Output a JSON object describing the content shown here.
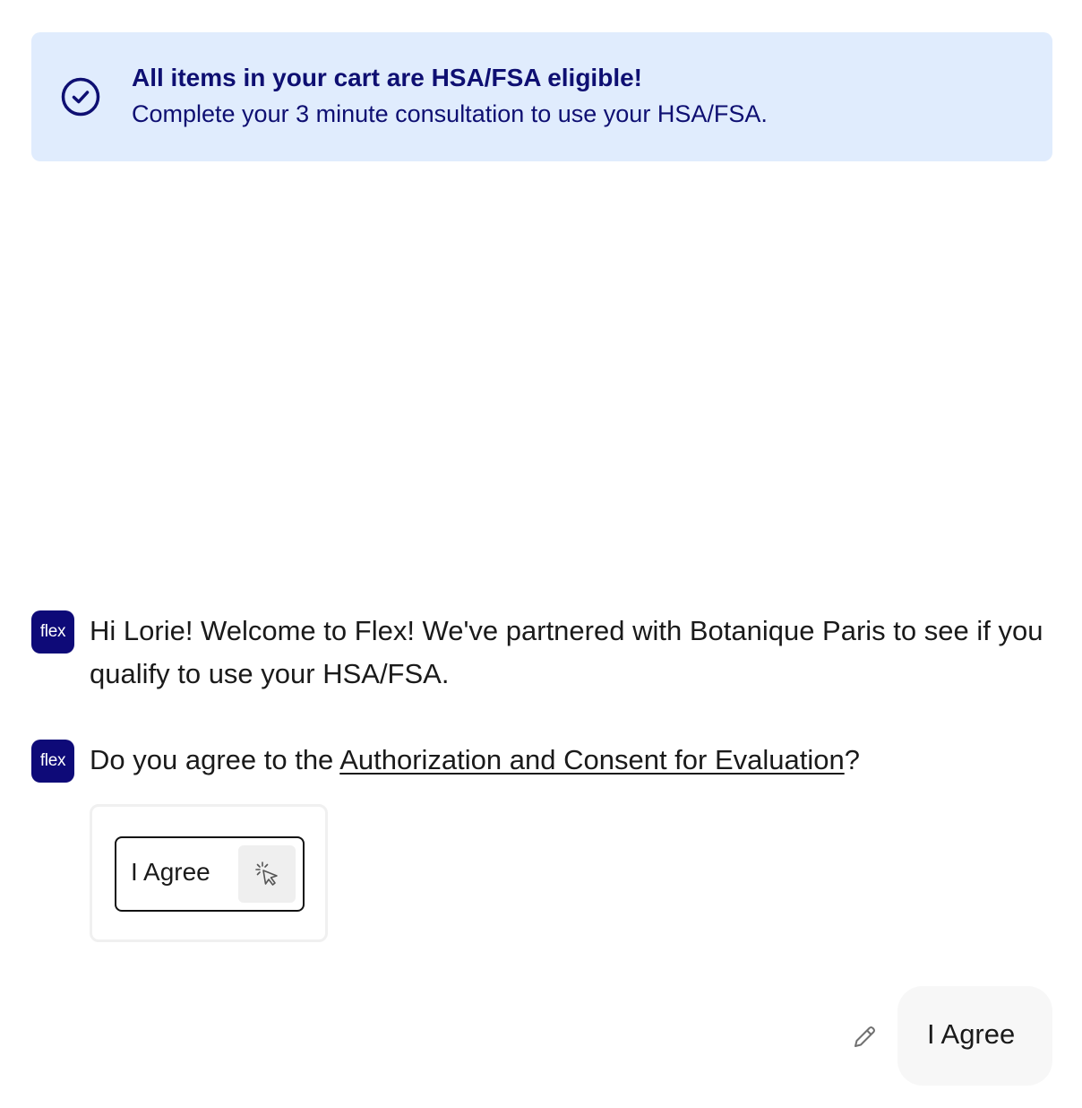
{
  "banner": {
    "title": "All items in your cart are HSA/FSA eligible!",
    "subtitle": "Complete your 3 minute consultation to use your HSA/FSA.",
    "icon": "check-circle-icon",
    "background": "#e0ecfd",
    "text_color": "#0e0f72"
  },
  "chat": {
    "avatar_label": "flex",
    "avatar_color": "#0e0a78",
    "messages": [
      {
        "sender": "bot",
        "text": "Hi Lorie! Welcome to Flex! We've partnered with Botanique Paris to see if you qualify to use your HSA/FSA."
      },
      {
        "sender": "bot",
        "prefix": "Do you agree to the ",
        "link_text": "Authorization and Consent for Evaluation",
        "suffix": "?"
      }
    ],
    "choice": {
      "label": "I Agree",
      "icon": "pointer-click-icon"
    },
    "user_reply": {
      "text": "I Agree",
      "edit_icon": "pencil-icon"
    }
  }
}
